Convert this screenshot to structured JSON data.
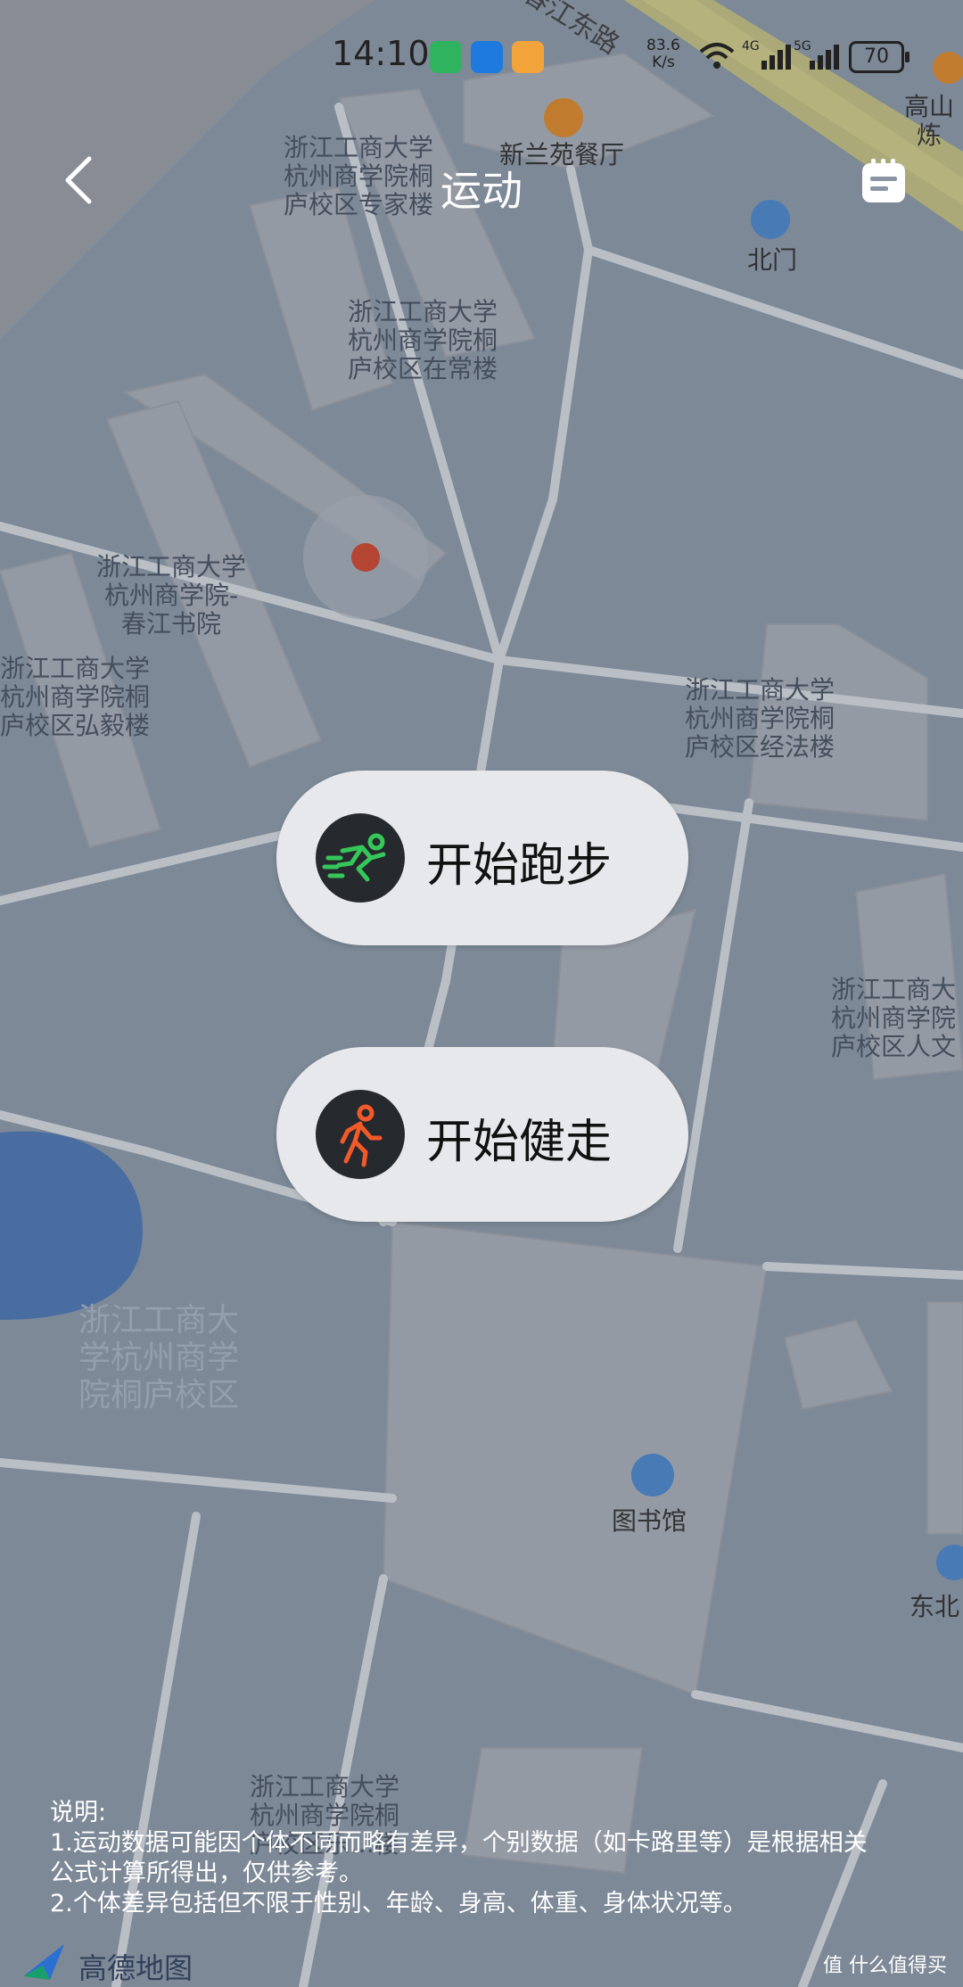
{
  "status_bar": {
    "time": "14:10",
    "net_speed_value": "83.6",
    "net_speed_unit": "K/s",
    "net_type_1": "4G",
    "net_type_2": "5G",
    "battery": "70",
    "app_icons": [
      "wechat-icon",
      "message-icon",
      "feeds-icon"
    ],
    "colors": {
      "wechat": "#2fb35e",
      "message": "#1f7ae0",
      "feeds": "#f2a33a"
    }
  },
  "header": {
    "title": "运动"
  },
  "map_labels": {
    "road_top": "春江东路",
    "restaurant": "新兰苑餐厅",
    "shop_top_right": "高山炼",
    "north_gate": "北门",
    "expert_bldg": "浙江工商大学\n杭州商学院桐\n庐校区专家楼",
    "zaichang_bldg": "浙江工商大学\n杭州商学院桐\n庐校区在常楼",
    "chunjiang_academy": "浙江工商大学\n杭州商学院-\n春江书院",
    "hongyi_bldg": "浙江工商大学\n杭州商学院桐\n庐校区弘毅楼",
    "jingfa_bldg": "浙江工商大学\n杭州商学院桐\n庐校区经法楼",
    "renwen_bldg": "浙江工商大\n杭州商学院\n庐校区人文",
    "campus": "浙江工商大\n学杭州商学\n院桐庐校区",
    "library": "图书馆",
    "east_north": "东北",
    "bottom_bldg": "浙江工商大学\n杭州商学院桐\n庐校区乐…楼"
  },
  "actions": {
    "run_label": "开始跑步",
    "walk_label": "开始健走",
    "run_icon_color": "#35c75a",
    "walk_icon_color": "#f25a2a"
  },
  "notes": {
    "heading": "说明:",
    "line1": "1.运动数据可能因个体不同而略有差异，个别数据（如卡路里等）是根据相关",
    "line1b": "公式计算所得出，仅供参考。",
    "line2": "2.个体差异包括但不限于性别、年龄、身高、体重、身体状况等。"
  },
  "map_logo": {
    "text": "高德地图"
  },
  "watermark": "值 什么值得买"
}
